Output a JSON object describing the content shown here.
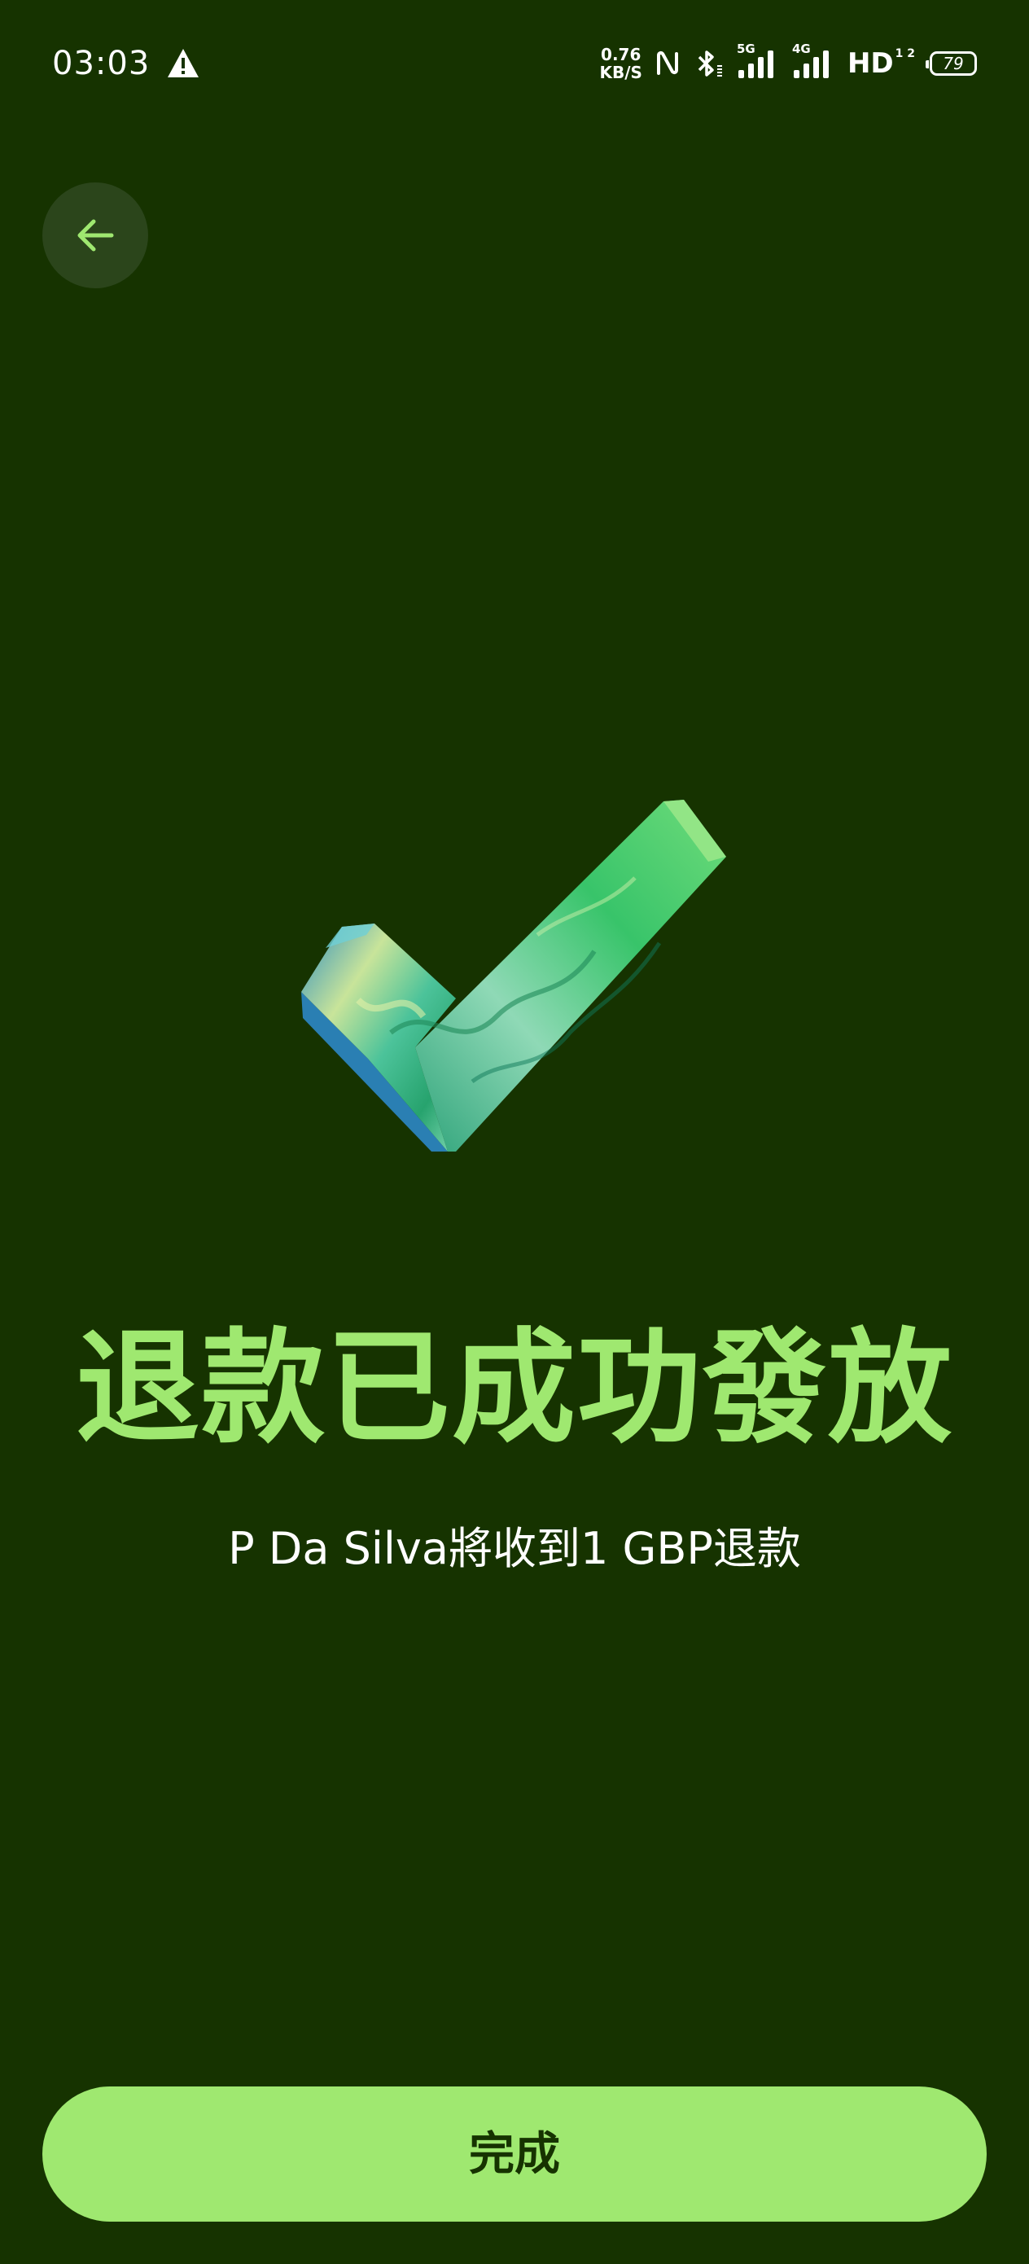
{
  "status_bar": {
    "time": "03:03",
    "net_speed_value": "0.76",
    "net_speed_unit": "KB/S",
    "network_5g": "5G",
    "network_4g": "4G",
    "hd": "HD",
    "hd_sub": "1 2",
    "battery": "79"
  },
  "header": {
    "back_icon": "arrow-left-icon"
  },
  "main": {
    "illustration": "checkmark-icon",
    "title": "退款已成功發放",
    "subtitle": "P Da Silva將收到1 GBP退款"
  },
  "footer": {
    "done_label": "完成"
  },
  "colors": {
    "background": "#163300",
    "accent": "#9fe870",
    "back_button_bg": "#2b451b",
    "text": "#ffffff"
  }
}
